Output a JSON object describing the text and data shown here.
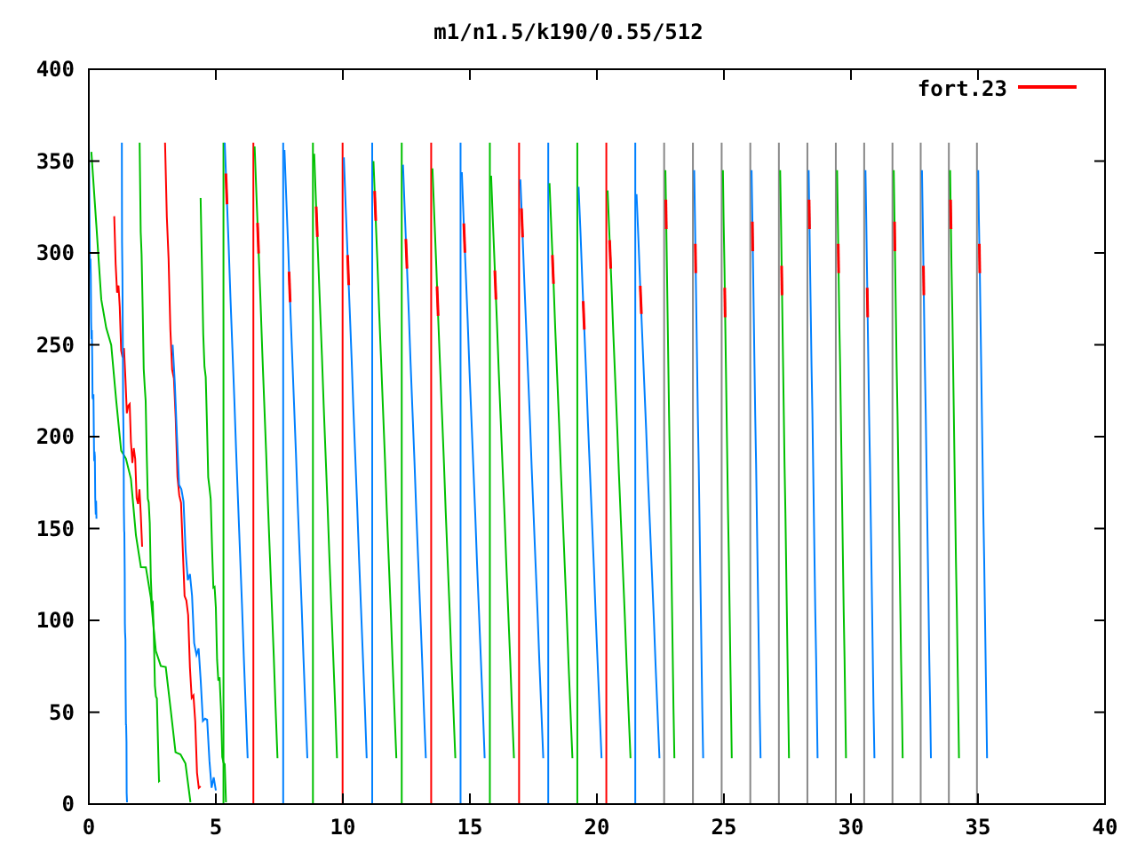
{
  "title": "m1/n1.5/k190/0.55/512",
  "legend": {
    "label": "fort.23",
    "color": "#ff0000"
  },
  "x_tick_labels": [
    "0",
    "5",
    "10",
    "15",
    "20",
    "25",
    "30",
    "35",
    "40"
  ],
  "y_tick_labels": [
    "400",
    "350",
    "300",
    "250",
    "200",
    "150",
    "100",
    "50",
    "0"
  ]
}
